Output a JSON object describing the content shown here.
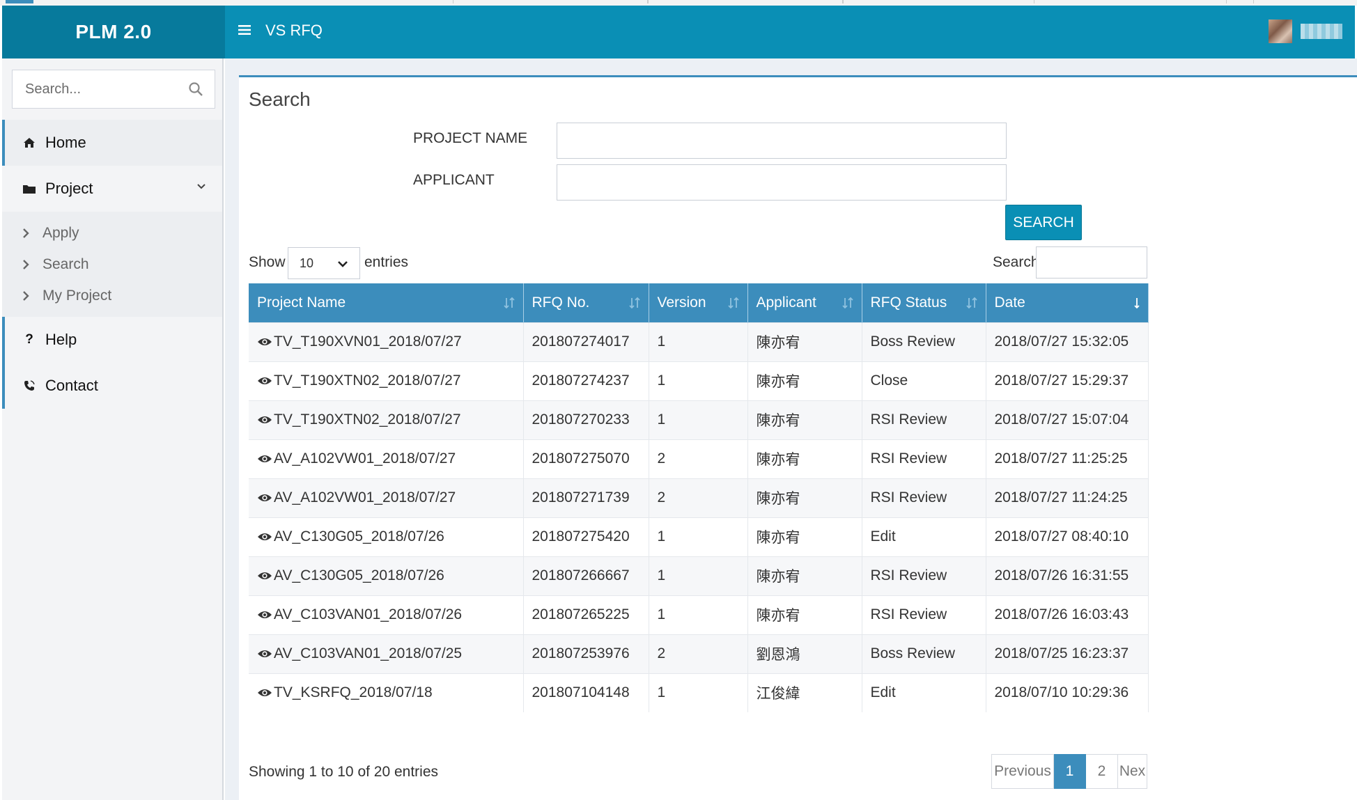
{
  "app": {
    "logo": "PLM 2.0",
    "page_title": "VS RFQ"
  },
  "sidebar": {
    "search_placeholder": "Search...",
    "home": "Home",
    "project": "Project",
    "project_items": [
      "Apply",
      "Search",
      "My Project"
    ],
    "help": "Help",
    "contact": "Contact"
  },
  "form": {
    "title": "Search",
    "project_name_label": "PROJECT NAME",
    "applicant_label": "APPLICANT",
    "project_name_value": "",
    "applicant_value": "",
    "search_button": "SEARCH"
  },
  "table_controls": {
    "show_label": "Show",
    "page_length": "10",
    "entries_label": "entries",
    "filter_label": "Search:",
    "filter_value": ""
  },
  "table": {
    "columns": [
      "Project Name",
      "RFQ No.",
      "Version",
      "Applicant",
      "RFQ Status",
      "Date"
    ],
    "rows": [
      [
        "TV_T190XVN01_2018/07/27",
        "201807274017",
        "1",
        "陳亦宥",
        "Boss Review",
        "2018/07/27 15:32:05"
      ],
      [
        "TV_T190XTN02_2018/07/27",
        "201807274237",
        "1",
        "陳亦宥",
        "Close",
        "2018/07/27 15:29:37"
      ],
      [
        "TV_T190XTN02_2018/07/27",
        "201807270233",
        "1",
        "陳亦宥",
        "RSI Review",
        "2018/07/27 15:07:04"
      ],
      [
        "AV_A102VW01_2018/07/27",
        "201807275070",
        "2",
        "陳亦宥",
        "RSI Review",
        "2018/07/27 11:25:25"
      ],
      [
        "AV_A102VW01_2018/07/27",
        "201807271739",
        "2",
        "陳亦宥",
        "RSI Review",
        "2018/07/27 11:24:25"
      ],
      [
        "AV_C130G05_2018/07/26",
        "201807275420",
        "1",
        "陳亦宥",
        "Edit",
        "2018/07/27 08:40:10"
      ],
      [
        "AV_C130G05_2018/07/26",
        "201807266667",
        "1",
        "陳亦宥",
        "RSI Review",
        "2018/07/26 16:31:55"
      ],
      [
        "AV_C103VAN01_2018/07/26",
        "201807265225",
        "1",
        "陳亦宥",
        "RSI Review",
        "2018/07/26 16:03:43"
      ],
      [
        "AV_C103VAN01_2018/07/25",
        "201807253976",
        "2",
        "劉恩鴻",
        "Boss Review",
        "2018/07/25 16:23:37"
      ],
      [
        "TV_KSRFQ_2018/07/18",
        "201807104148",
        "1",
        "江俊緯",
        "Edit",
        "2018/07/10 10:29:36"
      ]
    ]
  },
  "pagination": {
    "info": "Showing 1 to 10 of 20 entries",
    "previous": "Previous",
    "pages": [
      "1",
      "2"
    ],
    "next": "Nex"
  },
  "colors": {
    "header": "#0a8fb5",
    "logo_bg": "#077a9c",
    "accent": "#3c8dbc"
  }
}
